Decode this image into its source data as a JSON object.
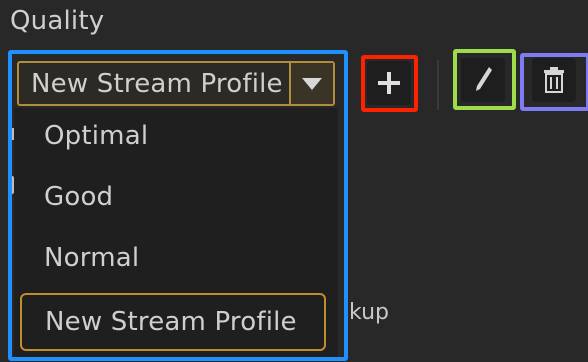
{
  "section": {
    "title": "Quality"
  },
  "select": {
    "value": "New Stream Profile",
    "options": [
      "Optimal",
      "Good",
      "Normal",
      "New Stream Profile"
    ]
  },
  "background": {
    "partial_text": "kup"
  },
  "toolbar": {
    "add_icon": "plus-icon",
    "edit_icon": "pencil-icon",
    "delete_icon": "trash-icon"
  },
  "highlights": {
    "blue": "#1e90ff",
    "red": "#ff2200",
    "green": "#9edc4c",
    "purple": "#7e7cf0"
  }
}
